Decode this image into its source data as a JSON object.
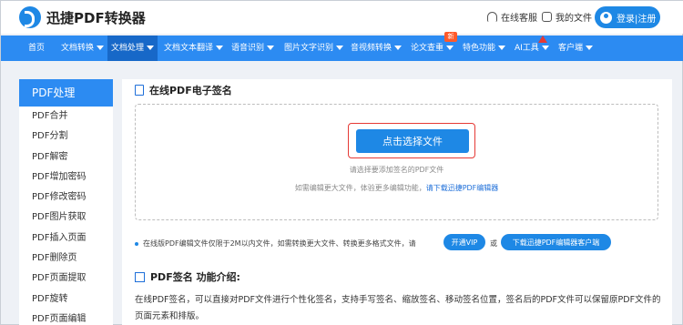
{
  "header": {
    "brand": "迅捷PDF转换器",
    "service": "在线客服",
    "my_files": "我的文件",
    "login": "登录|注册"
  },
  "nav": {
    "items": [
      "首页",
      "文档转换",
      "文档处理",
      "文档文本翻译",
      "语音识别",
      "图片文字识别",
      "音视频转换",
      "论文查重",
      "特色功能",
      "AI工具",
      "客户端"
    ],
    "badge": "新"
  },
  "sidebar": {
    "title": "PDF处理",
    "items": [
      "PDF合并",
      "PDF分割",
      "PDF解密",
      "PDF增加密码",
      "PDF修改密码",
      "PDF图片获取",
      "PDF插入页面",
      "PDF删除页",
      "PDF页面提取",
      "PDF旋转",
      "PDF页面编辑"
    ]
  },
  "main": {
    "section_title": "在线PDF电子签名",
    "choose_button": "点击选择文件",
    "hint1": "请选择要添加签名的PDF文件",
    "hint2_prefix": "如需编辑更大文件，体验更多编辑功能，",
    "hint2_link": "请下载迅捷PDF编辑器",
    "notice": "在线版PDF编辑文件仅限于2M以内文件，如需转换更大文件、转换更多格式文件，请",
    "vip_button": "开通VIP",
    "or": "或",
    "download_button": "下载迅捷PDF编辑器客户端",
    "intro_title": "PDF签名 功能介绍:",
    "intro_text": "在线PDF签名，可以直接对PDF文件进行个性化签名，支持手写签名、缩放签名、移动签名位置，签名后的PDF文件可以保留原PDF文件的页面元素和排版。"
  },
  "colors": {
    "primary": "#2c8bf2",
    "nav_active": "#1768c8",
    "highlight": "#e53935"
  }
}
